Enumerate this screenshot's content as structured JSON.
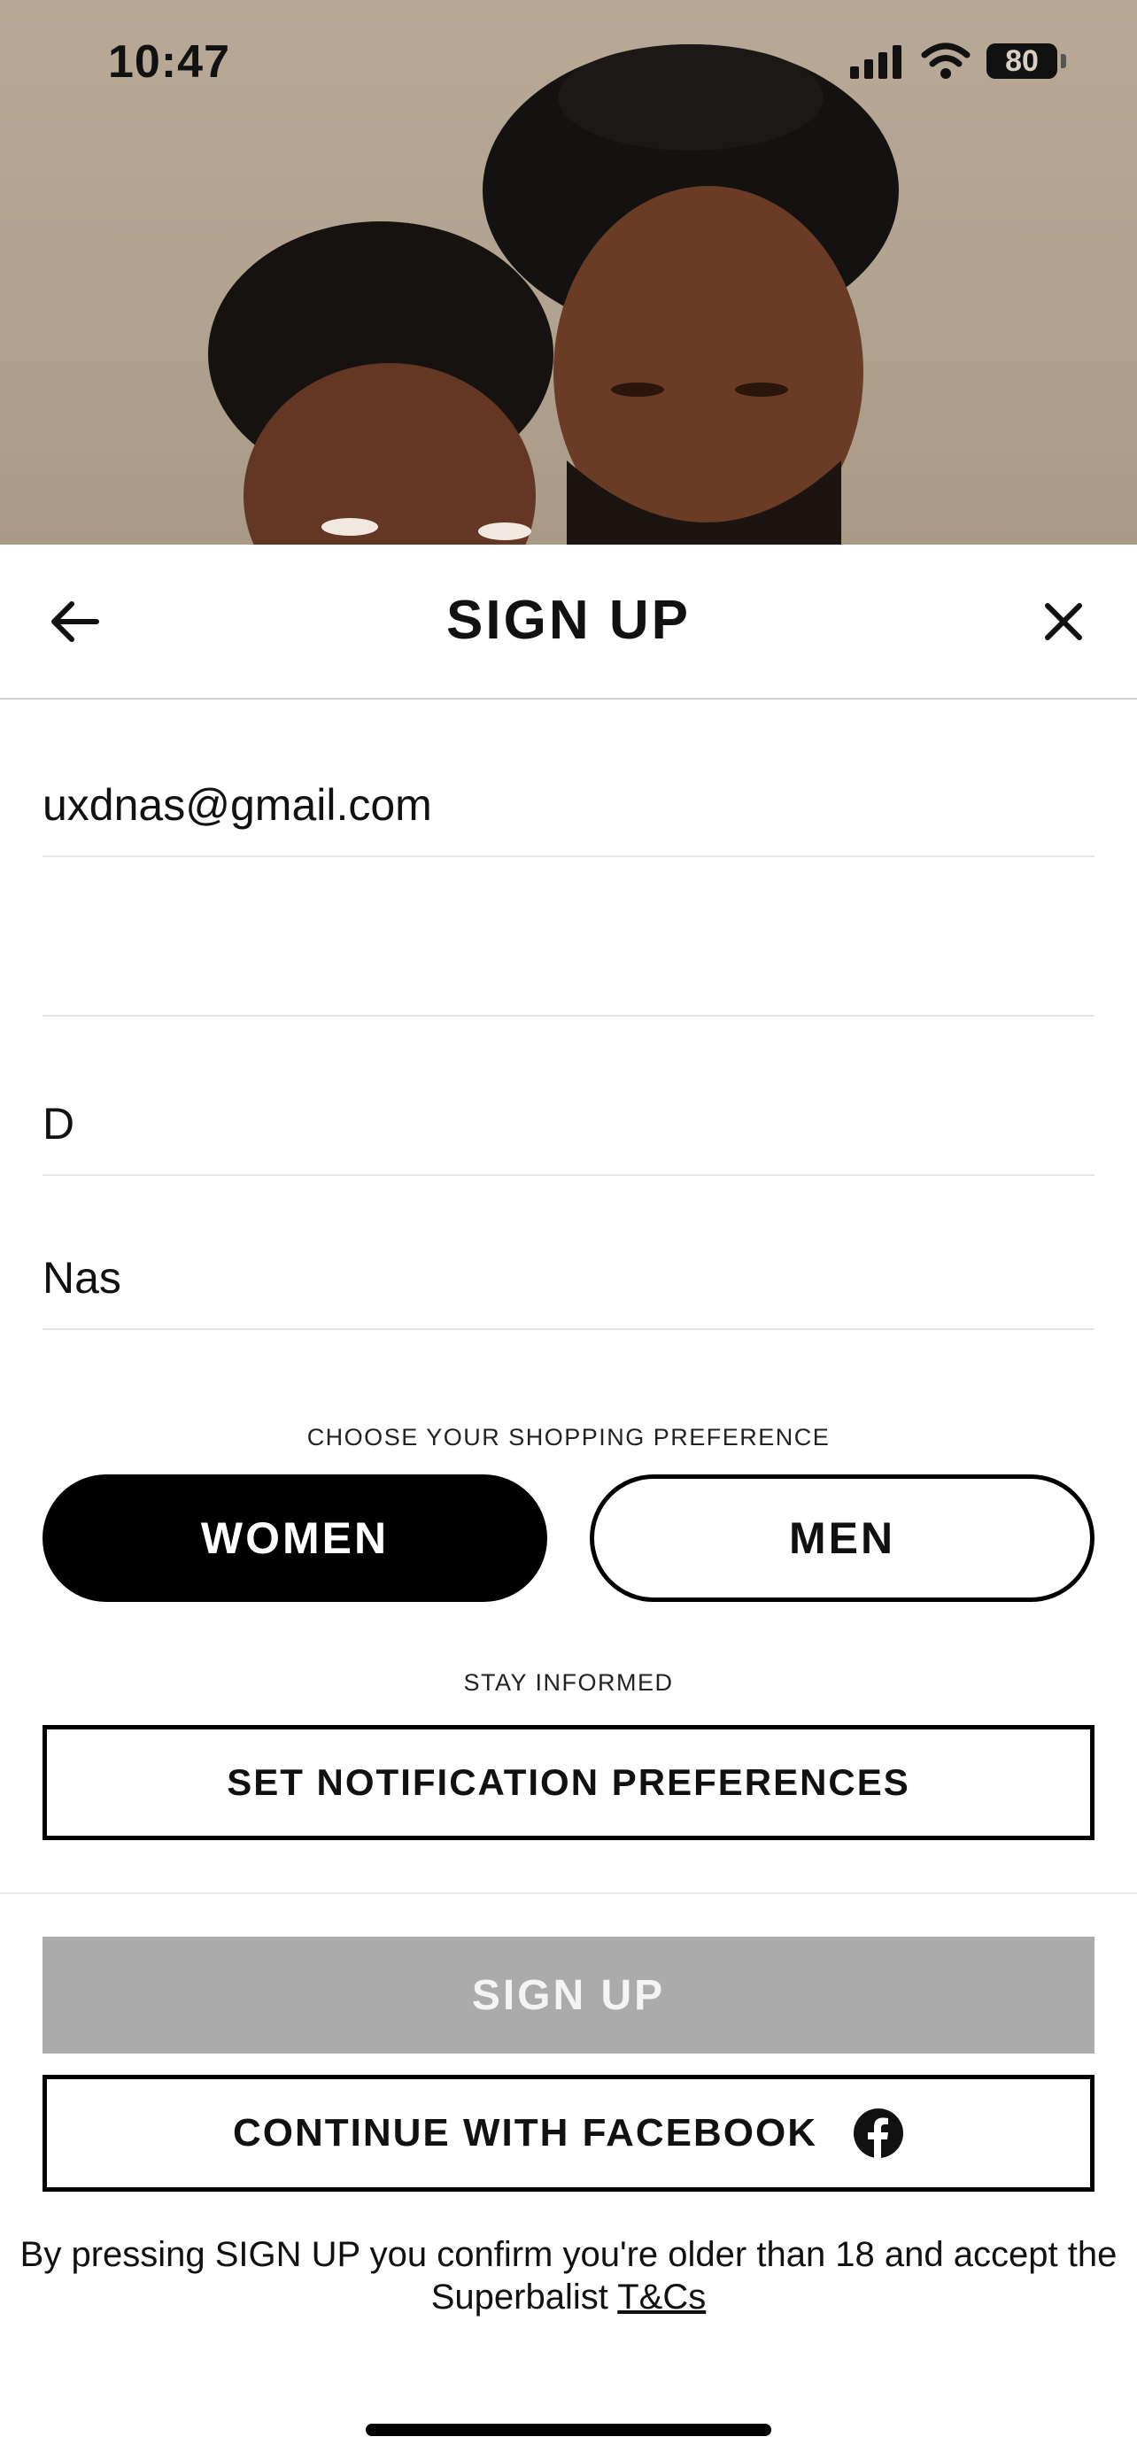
{
  "status_bar": {
    "time": "10:47",
    "battery": "80"
  },
  "header": {
    "title": "SIGN UP"
  },
  "form": {
    "email_value": "uxdnas@gmail.com",
    "password_value": "",
    "first_name_value": "D",
    "last_name_value": "Nas"
  },
  "shopping_preference": {
    "label": "CHOOSE YOUR SHOPPING PREFERENCE",
    "options": [
      "WOMEN",
      "MEN"
    ],
    "selected": "WOMEN"
  },
  "notifications": {
    "label": "STAY INFORMED",
    "button_label": "SET NOTIFICATION PREFERENCES"
  },
  "actions": {
    "signup_label": "SIGN UP",
    "facebook_label": "CONTINUE WITH FACEBOOK"
  },
  "terms": {
    "prefix": "By pressing SIGN UP you confirm you're older than 18 and accept the Superbalist ",
    "link": "T&Cs"
  },
  "colors": {
    "primary": "#000000",
    "disabled_button": "#ababab",
    "hero_background": "#b7a996"
  },
  "icons": [
    "signal-icon",
    "wifi-icon",
    "battery-icon",
    "back-arrow-icon",
    "close-icon",
    "facebook-icon"
  ]
}
